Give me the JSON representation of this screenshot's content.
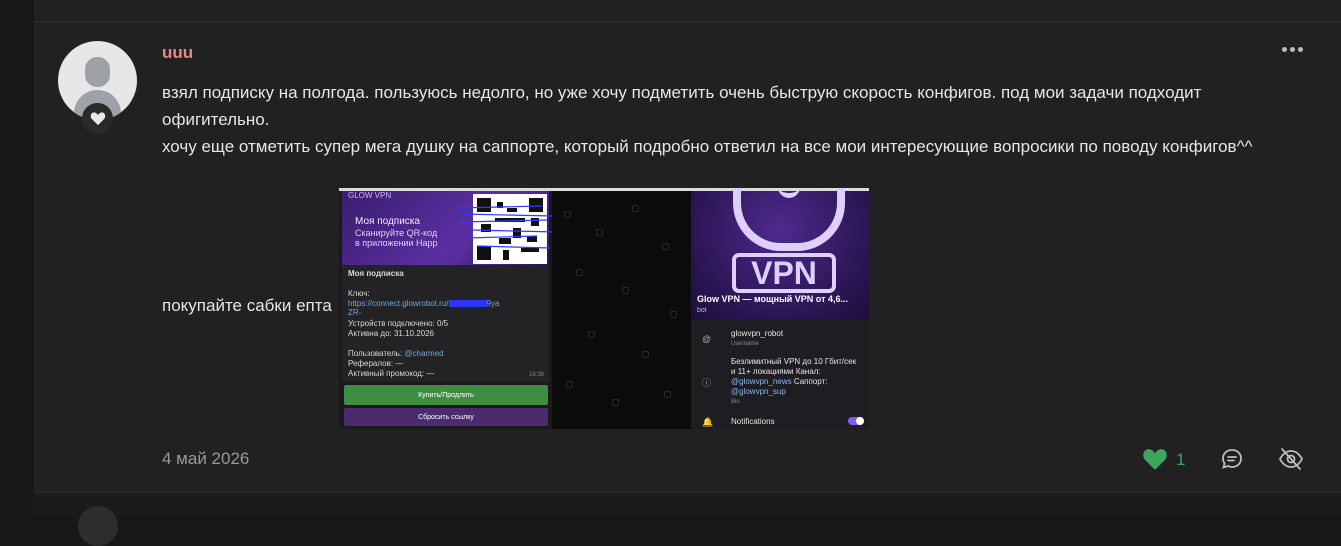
{
  "post": {
    "username": "uuu",
    "paragraph_1": "взял подписку на полгода. пользуюсь недолго, но уже хочу подметить очень быструю скорость конфигов. под мои задачи подходит офигительно.",
    "paragraph_2": "хочу еще отметить супер мега душку на саппорте, который подробно ответил на все мои интересующие вопросики по поводу конфигов^^",
    "paragraph_3": "покупайте сабки епта",
    "date": "4 май 2026",
    "like_count": "1"
  },
  "screenshot": {
    "left": {
      "logo": "GLOW VPN",
      "banner_title": "Моя подписка",
      "banner_line_1": "Сканируйте QR-код",
      "banner_line_2": "в приложении Happ",
      "card_title": "Моя подписка",
      "key_label": "Ключ:",
      "key_link": "https://connect.glowrobot.ru/",
      "key_suffix": "9ya",
      "key_cont": "ZR-",
      "devices": "Устройств подключено: 0/5",
      "active_until": "Активна до: 31.10.2026",
      "user_label": "Пользователь:",
      "user_value": "@charmed",
      "referrals": "Рефералов: —",
      "promo": "Активный промокод: —",
      "msg_time": "16:36",
      "button_buy": "Купить/Продлить",
      "button_reset": "Сбросить ссылку"
    },
    "right": {
      "vpn_word": "VPN",
      "title": "Glow VPN — мощный VPN от 4,6...",
      "subtitle": "bot",
      "username_value": "glowvpn_robot",
      "username_label": "Username",
      "bio_line_1": "Безлимитный VPN до 10 Гбит/сек",
      "bio_line_2": "и 11+ локациями",
      "bio_channel": "Канал:",
      "bio_line_3": "@glowvpn_news",
      "bio_support": "Саппорт:",
      "bio_line_4": "@glowvpn_sup",
      "bio_label": "Bio",
      "notifications": "Notifications"
    }
  },
  "colors": {
    "username": "#e8888b",
    "like": "#3ea55c",
    "background": "#212121"
  },
  "icons": [
    "heart-icon",
    "more-options-icon",
    "reply-icon",
    "hide-icon"
  ]
}
